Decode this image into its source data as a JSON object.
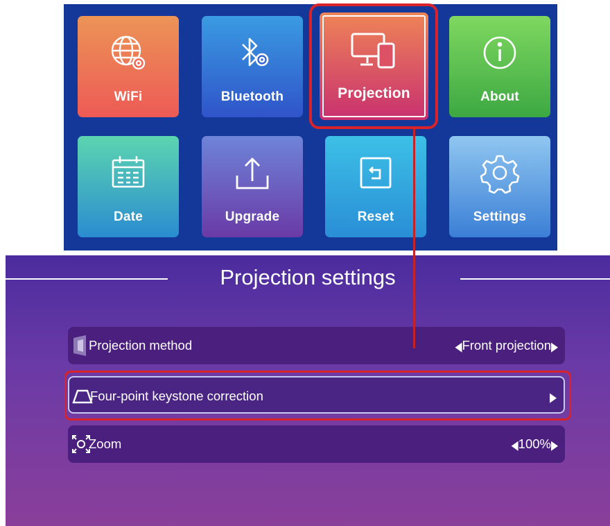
{
  "menu": {
    "tiles": [
      {
        "label": "WiFi",
        "icon": "globe-gear-icon"
      },
      {
        "label": "Bluetooth",
        "icon": "bluetooth-gear-icon"
      },
      {
        "label": "Projection",
        "icon": "monitor-phone-icon"
      },
      {
        "label": "About",
        "icon": "info-icon"
      },
      {
        "label": "Date",
        "icon": "calendar-icon"
      },
      {
        "label": "Upgrade",
        "icon": "upload-icon"
      },
      {
        "label": "Reset",
        "icon": "reset-icon"
      },
      {
        "label": "Settings",
        "icon": "gear-icon"
      }
    ],
    "selected": "Projection"
  },
  "settings": {
    "title": "Projection settings",
    "rows": [
      {
        "label": "Projection method",
        "value": "Front projection",
        "icon": "projection-method-icon"
      },
      {
        "label": "Four-point keystone correction",
        "value": "",
        "icon": "trapezoid-icon"
      },
      {
        "label": "Zoom",
        "value": "100%",
        "icon": "zoom-corners-icon"
      }
    ]
  },
  "colors": {
    "menu_bg": "#13389a",
    "highlight": "#d8232a",
    "settings_bg_top": "#4b2c9e",
    "settings_bg_bottom": "#8a3f9a",
    "row_bg": "#4a1f7e"
  }
}
